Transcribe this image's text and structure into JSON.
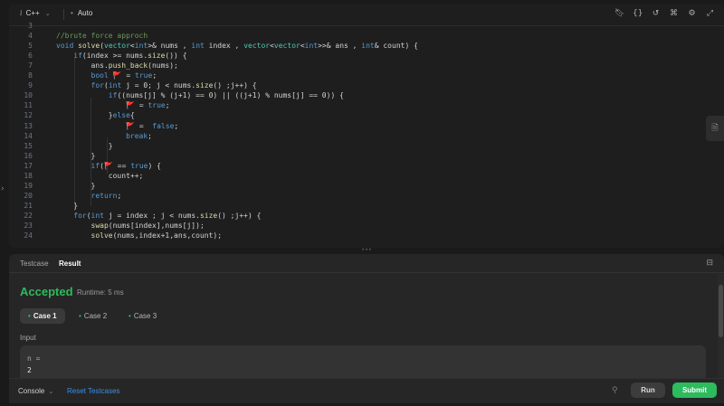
{
  "editor": {
    "language": "C++",
    "language_prefix": "i",
    "mode": "Auto",
    "toolbar_icons": [
      "bookmark-icon",
      "braces-icon",
      "undo-icon",
      "command-icon",
      "settings-icon",
      "expand-icon"
    ],
    "line_numbers": [
      "3",
      "4",
      "5",
      "6",
      "7",
      "8",
      "9",
      "10",
      "11",
      "12",
      "13",
      "14",
      "15",
      "16",
      "17",
      "18",
      "19",
      "20",
      "21",
      "22",
      "23",
      "24"
    ],
    "lines": [
      [
        {
          "t": "",
          "c": ""
        }
      ],
      [
        {
          "t": "//brute force approch",
          "c": "c"
        }
      ],
      [
        {
          "t": "void ",
          "c": "k"
        },
        {
          "t": "solve",
          "c": "f"
        },
        {
          "t": "(",
          "c": ""
        },
        {
          "t": "vector",
          "c": "t"
        },
        {
          "t": "<",
          "c": ""
        },
        {
          "t": "int",
          "c": "k"
        },
        {
          "t": ">& nums , ",
          "c": ""
        },
        {
          "t": "int",
          "c": "k"
        },
        {
          "t": " index , ",
          "c": ""
        },
        {
          "t": "vector",
          "c": "t"
        },
        {
          "t": "<",
          "c": ""
        },
        {
          "t": "vector",
          "c": "t"
        },
        {
          "t": "<",
          "c": ""
        },
        {
          "t": "int",
          "c": "k"
        },
        {
          "t": ">>& ans , ",
          "c": ""
        },
        {
          "t": "int",
          "c": "k"
        },
        {
          "t": "& count) {",
          "c": ""
        }
      ],
      [
        {
          "t": "    if",
          "c": "k"
        },
        {
          "t": "(index >= nums.",
          "c": ""
        },
        {
          "t": "size",
          "c": "f"
        },
        {
          "t": "()) {",
          "c": ""
        }
      ],
      [
        {
          "t": "        ans.",
          "c": ""
        },
        {
          "t": "push_back",
          "c": "f"
        },
        {
          "t": "(nums);",
          "c": ""
        }
      ],
      [
        {
          "t": "        bool ",
          "c": "k"
        },
        {
          "t": "🚩",
          "c": "fl"
        },
        {
          "t": " = ",
          "c": ""
        },
        {
          "t": "true",
          "c": "k"
        },
        {
          "t": ";",
          "c": ""
        }
      ],
      [
        {
          "t": "        for",
          "c": "k"
        },
        {
          "t": "(",
          "c": ""
        },
        {
          "t": "int",
          "c": "k"
        },
        {
          "t": " j = 0; j < nums.",
          "c": ""
        },
        {
          "t": "size",
          "c": "f"
        },
        {
          "t": "() ;j++) {",
          "c": ""
        }
      ],
      [
        {
          "t": "            if",
          "c": "k"
        },
        {
          "t": "((nums[j] % (j+1) == 0) || ((j+1) % nums[j] == 0)) {",
          "c": ""
        }
      ],
      [
        {
          "t": "                ",
          "c": ""
        },
        {
          "t": "🚩",
          "c": "fl"
        },
        {
          "t": " = ",
          "c": ""
        },
        {
          "t": "true",
          "c": "k"
        },
        {
          "t": ";",
          "c": ""
        }
      ],
      [
        {
          "t": "            }",
          "c": ""
        },
        {
          "t": "else",
          "c": "k"
        },
        {
          "t": "{",
          "c": ""
        }
      ],
      [
        {
          "t": "                ",
          "c": ""
        },
        {
          "t": "🚩",
          "c": "fl"
        },
        {
          "t": " =  ",
          "c": ""
        },
        {
          "t": "false",
          "c": "k"
        },
        {
          "t": ";",
          "c": ""
        }
      ],
      [
        {
          "t": "                break",
          "c": "k"
        },
        {
          "t": ";",
          "c": ""
        }
      ],
      [
        {
          "t": "            }",
          "c": ""
        }
      ],
      [
        {
          "t": "        }",
          "c": ""
        }
      ],
      [
        {
          "t": "        if",
          "c": "k"
        },
        {
          "t": "(",
          "c": ""
        },
        {
          "t": "🚩",
          "c": "fl"
        },
        {
          "t": " == ",
          "c": ""
        },
        {
          "t": "true",
          "c": "k"
        },
        {
          "t": ") {",
          "c": ""
        }
      ],
      [
        {
          "t": "            count++;",
          "c": ""
        }
      ],
      [
        {
          "t": "        }",
          "c": ""
        }
      ],
      [
        {
          "t": "        return",
          "c": "k"
        },
        {
          "t": ";",
          "c": ""
        }
      ],
      [
        {
          "t": "    }",
          "c": ""
        }
      ],
      [
        {
          "t": "    for",
          "c": "k"
        },
        {
          "t": "(",
          "c": ""
        },
        {
          "t": "int",
          "c": "k"
        },
        {
          "t": " j = index ; j < nums.",
          "c": ""
        },
        {
          "t": "size",
          "c": "f"
        },
        {
          "t": "() ;j++) {",
          "c": ""
        }
      ],
      [
        {
          "t": "        ",
          "c": ""
        },
        {
          "t": "swap",
          "c": "f"
        },
        {
          "t": "(nums[index],nums[j]);",
          "c": ""
        }
      ],
      [
        {
          "t": "        ",
          "c": ""
        },
        {
          "t": "solve",
          "c": "f"
        },
        {
          "t": "(nums,index+1,ans,count);",
          "c": ""
        }
      ]
    ]
  },
  "panel": {
    "tabs": [
      {
        "label": "Testcase",
        "active": false
      },
      {
        "label": "Result",
        "active": true
      }
    ],
    "status": "Accepted",
    "runtime": "Runtime: 5 ms",
    "cases": [
      {
        "label": "Case 1",
        "active": true
      },
      {
        "label": "Case 2",
        "active": false
      },
      {
        "label": "Case 3",
        "active": false
      }
    ],
    "input_label": "Input",
    "input_name": "n =",
    "input_value": "2"
  },
  "bottombar": {
    "console": "Console",
    "reset": "Reset Testcases",
    "run": "Run",
    "submit": "Submit"
  },
  "colors": {
    "accent_green": "#2cbb5d",
    "link_blue": "#3b8eea",
    "flag_red": "#f14c4c"
  }
}
